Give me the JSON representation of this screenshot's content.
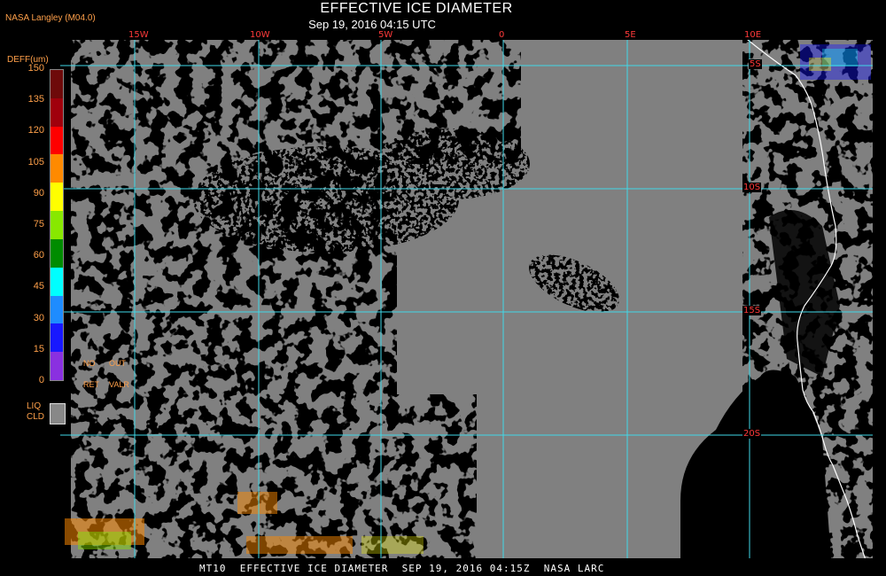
{
  "title": "EFFECTIVE ICE DIAMETER",
  "subtitle": "Sep 19, 2016 04:15 UTC",
  "provider": "NASA Langley (M04.0)",
  "legend": {
    "title": "DEFF(um)",
    "ticks": [
      "150",
      "135",
      "120",
      "105",
      "90",
      "75",
      "60",
      "45",
      "30",
      "15",
      "0"
    ],
    "colors": [
      "#6e0a0a",
      "#a0000c",
      "#ff0000",
      "#ff8a00",
      "#ffff00",
      "#88e800",
      "#008c00",
      "#00ffff",
      "#1e8cff",
      "#1818ff",
      "#8a30e0"
    ],
    "flags": [
      "NO",
      "OUT",
      "RET",
      "VALR"
    ],
    "liq_label_1": "LIQ",
    "liq_label_2": "CLD",
    "liq_color": "#888888"
  },
  "grid": {
    "lon_labels": [
      "15W",
      "10W",
      "5W",
      "0",
      "5E",
      "10E"
    ],
    "lat_labels": [
      "5S",
      "10S",
      "15S",
      "20S"
    ],
    "line_color": "#40d8e8"
  },
  "map_colors": {
    "ocean": "#000000",
    "ice_cloud_gray": "#808080",
    "coast": "#ffffff"
  },
  "footer": "MT10  EFFECTIVE ICE DIAMETER  SEP 19, 2016 04:15Z  NASA LARC"
}
